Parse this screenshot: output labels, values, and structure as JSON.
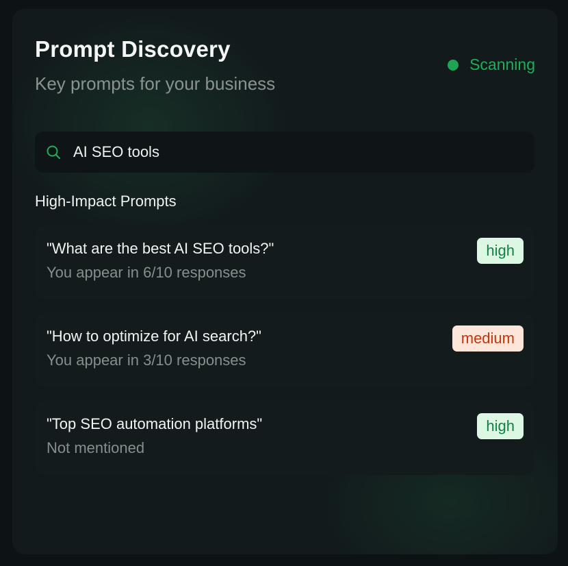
{
  "header": {
    "title": "Prompt Discovery",
    "subtitle": "Key prompts for your business"
  },
  "status": {
    "label": "Scanning",
    "color": "#1ea554"
  },
  "search": {
    "icon": "search-icon",
    "value": "AI SEO tools"
  },
  "section": {
    "heading": "High-Impact Prompts"
  },
  "prompts": [
    {
      "text": "\"What are the best AI SEO tools?\"",
      "detail": "You appear in 6/10 responses",
      "impact": "high"
    },
    {
      "text": "\"How to optimize for AI search?\"",
      "detail": "You appear in 3/10 responses",
      "impact": "medium"
    },
    {
      "text": "\"Top SEO automation platforms\"",
      "detail": "Not mentioned",
      "impact": "high"
    }
  ],
  "colors": {
    "accent": "#22ad58",
    "high_badge_bg": "#dcf8e5",
    "high_badge_text": "#138040",
    "medium_badge_bg": "#fde6d9",
    "medium_badge_text": "#c2350f"
  }
}
